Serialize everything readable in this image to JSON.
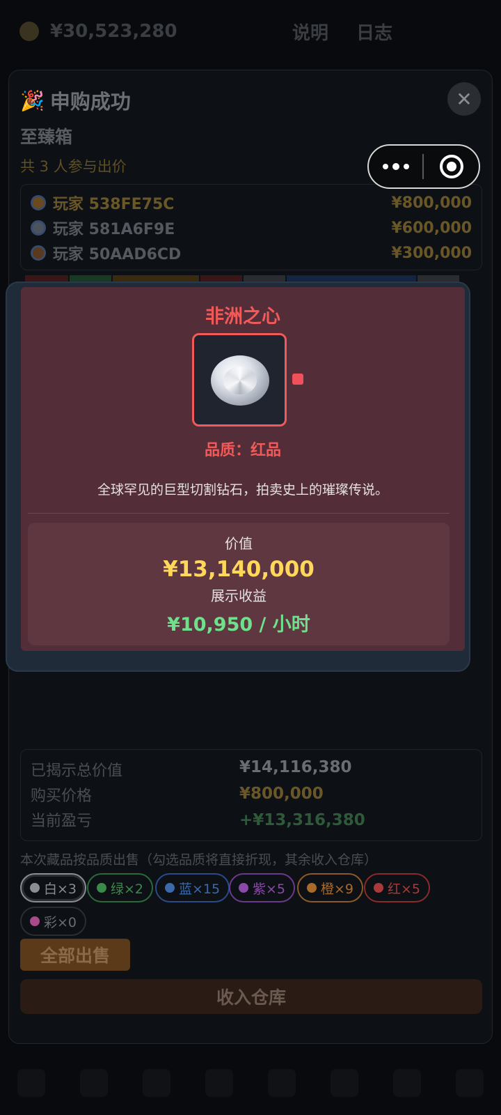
{
  "background": {
    "balance": "¥30,523,280",
    "tabs": [
      "说明",
      "日志"
    ]
  },
  "modal": {
    "title": "申购成功",
    "box_name": "至臻箱",
    "participants": "共 3 人参与出价",
    "bids": [
      {
        "player": "玩家 538FE75C",
        "amount": "¥800,000"
      },
      {
        "player": "玩家 581A6F9E",
        "amount": "¥600,000"
      },
      {
        "player": "玩家 50AAD6CD",
        "amount": "¥300,000"
      }
    ]
  },
  "reveal": {
    "item_name": "非洲之心",
    "quality": "品质：红品",
    "description": "全球罕见的巨型切割钻石，拍卖史上的璀璨传说。",
    "value_label": "价值",
    "value": "¥13,140,000",
    "income_label": "展示收益",
    "income": "¥10,950 / 小时"
  },
  "summary": {
    "total_label": "已揭示总价值",
    "total_value": "¥14,116,380",
    "price_label": "购买价格",
    "price_value": "¥800,000",
    "pnl_label": "当前盈亏",
    "pnl_value": "+¥13,316,380"
  },
  "sell": {
    "note": "本次藏品按品质出售（勾选品质将直接折现，其余收入仓库）",
    "chips": [
      {
        "label": "白×3",
        "color": "#8a8d92"
      },
      {
        "label": "绿×2",
        "color": "#3a8a4a"
      },
      {
        "label": "蓝×15",
        "color": "#3a6aaa"
      },
      {
        "label": "紫×5",
        "color": "#8a4aaa"
      },
      {
        "label": "橙×9",
        "color": "#aa6a2a"
      },
      {
        "label": "红×5",
        "color": "#aa3a3a"
      },
      {
        "label": "彩×0",
        "color": "#aa4a8a"
      }
    ],
    "sell_all": "全部出售",
    "store": "收入仓库"
  },
  "colors": {
    "accent_red": "#f25a5a",
    "value_gold": "#ffd75a",
    "income_green": "#6fe08c",
    "card_bg": "#532e38"
  }
}
